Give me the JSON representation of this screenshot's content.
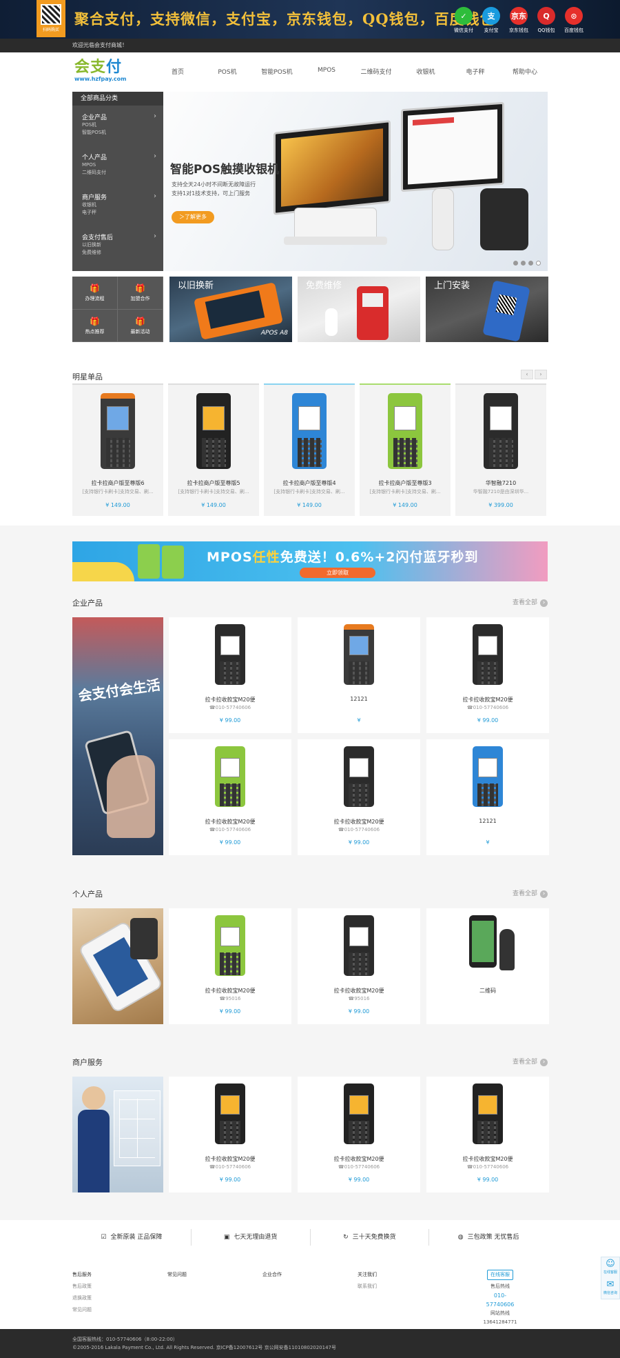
{
  "topbar": {
    "qr_caption": "扫码购买",
    "slogan": "聚合支付，支持微信，支付宝，京东钱包，QQ钱包，百度钱包",
    "pay_methods": [
      {
        "label": "微信支付",
        "icon": "wechat-pay-icon",
        "color": "#2ebd3b",
        "glyph": "✓"
      },
      {
        "label": "支付宝",
        "icon": "alipay-icon",
        "color": "#1a9bde",
        "glyph": "支"
      },
      {
        "label": "京东钱包",
        "icon": "jd-wallet-icon",
        "color": "#e6302b",
        "glyph": "京东"
      },
      {
        "label": "QQ钱包",
        "icon": "qq-wallet-icon",
        "color": "#d92b2b",
        "glyph": "Q"
      },
      {
        "label": "百度钱包",
        "icon": "baidu-wallet-icon",
        "color": "#e6302b",
        "glyph": "⊙"
      }
    ]
  },
  "welcome": "欢迎光临会支付商城！",
  "logo": {
    "main": "会支",
    "accent": "付",
    "url": "www.hzfpay.com"
  },
  "nav": [
    "首页",
    "POS机",
    "智能POS机",
    "MPOS",
    "二维码支付",
    "收银机",
    "电子秤",
    "帮助中心"
  ],
  "categories": {
    "title": "全部商品分类",
    "groups": [
      {
        "title": "企业产品",
        "subs": [
          "POS机",
          "智能POS机"
        ]
      },
      {
        "title": "个人产品",
        "subs": [
          "MPOS",
          "二维码支付"
        ]
      },
      {
        "title": "商户服务",
        "subs": [
          "收银机",
          "电子秤"
        ]
      },
      {
        "title": "会支付售后",
        "subs": [
          "以旧换新",
          "免费维修"
        ]
      }
    ]
  },
  "hero": {
    "title": "智能POS触摸收银机",
    "line1": "支持全天24小时不间断无故障运行",
    "line2": "支持1对1技术支持，可上门服务",
    "button": "＞了解更多",
    "slide_count": 4,
    "active_slide": 4
  },
  "services": [
    {
      "label": "办理流程",
      "glyph": "🎁"
    },
    {
      "label": "加盟合作",
      "glyph": "🎁"
    },
    {
      "label": "热点推荐",
      "glyph": "🎁"
    },
    {
      "label": "最新活动",
      "glyph": "🎁"
    }
  ],
  "promos": [
    {
      "label": "以旧换新",
      "sub": "APOS A8"
    },
    {
      "label": "免费维修",
      "sub": ""
    },
    {
      "label": "上门安装",
      "sub": ""
    }
  ],
  "star": {
    "title": "明星单品",
    "pager_prev": "‹",
    "pager_next": "›",
    "items": [
      {
        "name": "拉卡拉商户版至尊版6",
        "desc": "[支持银行卡刷卡]支持交易、刷...",
        "price": "¥ 149.00"
      },
      {
        "name": "拉卡拉商户版至尊版5",
        "desc": "[支持银行卡刷卡]支持交易、刷...",
        "price": "¥ 149.00"
      },
      {
        "name": "拉卡拉商户版至尊版4",
        "desc": "[支持银行卡刷卡]支持交易、刷...",
        "price": "¥ 149.00"
      },
      {
        "name": "拉卡拉商户版至尊版3",
        "desc": "[支持银行卡刷卡]支持交易、刷...",
        "price": "¥ 149.00"
      },
      {
        "name": "华智融7210",
        "desc": "华智融7210是由深圳华...",
        "price": "¥ 399.00"
      }
    ]
  },
  "ad": {
    "text_pre": "MPOS",
    "text_em": "任性",
    "text_post": "免费送！0.6%+2闪付蓝牙秒到",
    "cta": "立即领取"
  },
  "enterprise": {
    "title": "企业产品",
    "more": "查看全部",
    "side_text": "会支付会生活",
    "items": [
      {
        "name": "拉卡拉收款宝M20便",
        "tel": "☎010-57740606",
        "price": "¥ 99.00"
      },
      {
        "name": "12121",
        "tel": "",
        "price": "¥"
      },
      {
        "name": "拉卡拉收款宝M20便",
        "tel": "☎010-57740606",
        "price": "¥ 99.00"
      },
      {
        "name": "拉卡拉收款宝M20便",
        "tel": "☎010-57740606",
        "price": "¥ 99.00"
      },
      {
        "name": "拉卡拉收款宝M20便",
        "tel": "☎010-57740606",
        "price": "¥ 99.00"
      },
      {
        "name": "12121",
        "tel": "",
        "price": "¥"
      }
    ]
  },
  "personal": {
    "title": "个人产品",
    "more": "查看全部",
    "items": [
      {
        "name": "拉卡拉收款宝M20便",
        "tel": "☎95016",
        "price": "¥ 99.00"
      },
      {
        "name": "拉卡拉收款宝M20便",
        "tel": "☎95016",
        "price": "¥ 99.00"
      },
      {
        "name": "二维码",
        "tel": "",
        "price": ""
      }
    ]
  },
  "merchant": {
    "title": "商户服务",
    "more": "查看全部",
    "items": [
      {
        "name": "拉卡拉收款宝M20便",
        "tel": "☎010-57740606",
        "price": "¥ 99.00"
      },
      {
        "name": "拉卡拉收款宝M20便",
        "tel": "☎010-57740606",
        "price": "¥ 99.00"
      },
      {
        "name": "拉卡拉收款宝M20便",
        "tel": "☎010-57740606",
        "price": "¥ 99.00"
      }
    ]
  },
  "guarantees": [
    {
      "icon": "☑",
      "label": "全新原装 正品保障"
    },
    {
      "icon": "▣",
      "label": "七天无理由退货"
    },
    {
      "icon": "↻",
      "label": "三十天免费换货"
    },
    {
      "icon": "◍",
      "label": "三包政策 无忧售后"
    }
  ],
  "footer_cols": [
    {
      "title": "售后服务",
      "links": [
        "售后政策",
        "退换政策",
        "常见问题"
      ]
    },
    {
      "title": "常见问题",
      "links": []
    },
    {
      "title": "企业合作",
      "links": []
    },
    {
      "title": "关注我们",
      "links": [
        "联系我们"
      ]
    }
  ],
  "service_box": {
    "online": "在线客服",
    "label1": "售后热线",
    "tel1": "010-57740606",
    "label2": "网站热线",
    "tel2": "13641284771"
  },
  "bottom": {
    "line1": "全国客服热线：010-57740606（8:00-22:00）",
    "line2": "©2005-2016 Lakala Payment Co., Ltd. All Rights Reserved. 京ICP备12007612号 京公网安备11010802020147号"
  },
  "floatbar": {
    "top": "在线客服",
    "bottom": "微信咨询"
  }
}
